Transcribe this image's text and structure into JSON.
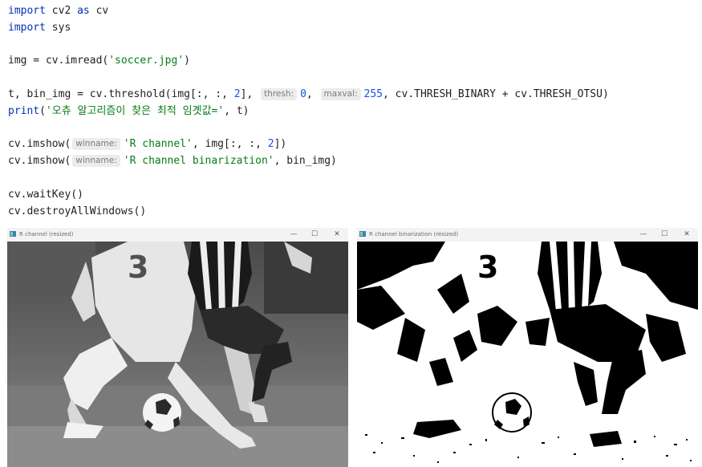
{
  "code": {
    "import1": {
      "kw": "import",
      "name": "cv2",
      "as_kw": "as",
      "alias": "cv"
    },
    "import2": {
      "kw": "import",
      "name": "sys"
    },
    "imread": {
      "pre": "img = cv.imread(",
      "arg": "'soccer.jpg'",
      "post": ")"
    },
    "threshold": {
      "pre": "t, bin_img = cv.threshold(img[:, :, ",
      "chan": "2",
      "mid": "], ",
      "hint1": "thresh:",
      "val1": "0",
      "comma1": ", ",
      "hint2": "maxval:",
      "val2": "255",
      "post": ", cv.THRESH_BINARY + cv.THRESH_OTSU)"
    },
    "print": {
      "fn": "print",
      "open": "(",
      "arg": "'오츄 알고리즘이 찾은 최적 임곗값='",
      "post": ", t)"
    },
    "imshow1": {
      "pre": "cv.imshow(",
      "hint": "winname:",
      "arg": "'R channel'",
      "mid": ", img[:, :, ",
      "chan": "2",
      "post": "])"
    },
    "imshow2": {
      "pre": "cv.imshow(",
      "hint": "winname:",
      "arg": "'R channel binarization'",
      "post": ", bin_img)"
    },
    "waitkey": "cv.waitKey()",
    "destroy": "cv.destroyAllWindows()"
  },
  "windows": [
    {
      "title": "R channel (resized)",
      "icons": [
        "minimize-icon",
        "maximize-icon",
        "close-icon"
      ],
      "minimize": "—",
      "maximize": "☐",
      "close": "✕"
    },
    {
      "title": "R channel binarization (resized)",
      "icons": [
        "minimize-icon",
        "maximize-icon",
        "close-icon"
      ],
      "minimize": "—",
      "maximize": "☐",
      "close": "✕"
    }
  ],
  "colors": {
    "keyword": "#0033b3",
    "string": "#067d17",
    "number": "#1750eb",
    "hint_bg": "#ececec"
  }
}
